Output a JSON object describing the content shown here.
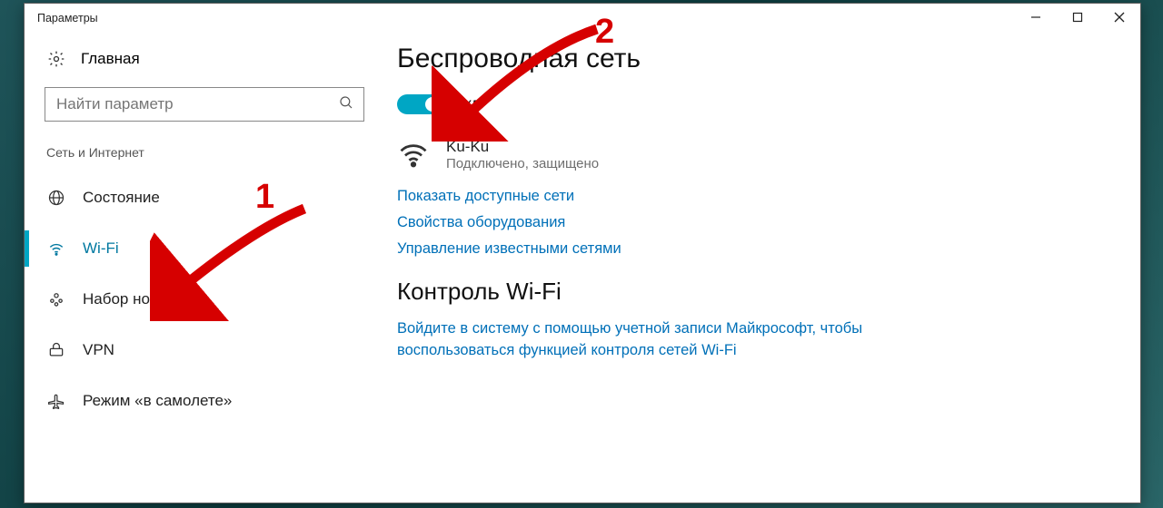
{
  "window": {
    "title": "Параметры"
  },
  "sidebar": {
    "home_label": "Главная",
    "search_placeholder": "Найти параметр",
    "group_label": "Сеть и Интернет",
    "items": [
      {
        "label": "Состояние",
        "icon": "globe-icon"
      },
      {
        "label": "Wi-Fi",
        "icon": "wifi-icon",
        "selected": true
      },
      {
        "label": "Набор номера",
        "icon": "dialup-icon"
      },
      {
        "label": "VPN",
        "icon": "vpn-icon"
      },
      {
        "label": "Режим «в самолете»",
        "icon": "airplane-icon"
      }
    ]
  },
  "main": {
    "title": "Беспроводная сеть",
    "toggle_label": "Вкл.",
    "network": {
      "name": "Ku-Ku",
      "status": "Подключено, защищено"
    },
    "links": {
      "available": "Показать доступные сети",
      "hardware": "Свойства оборудования",
      "known": "Управление известными сетями"
    },
    "section2_title": "Контроль Wi-Fi",
    "section2_text": "Войдите в систему с помощью учетной записи Майкрософт, чтобы воспользоваться функцией контроля сетей Wi-Fi"
  },
  "annotations": {
    "one": "1",
    "two": "2"
  }
}
